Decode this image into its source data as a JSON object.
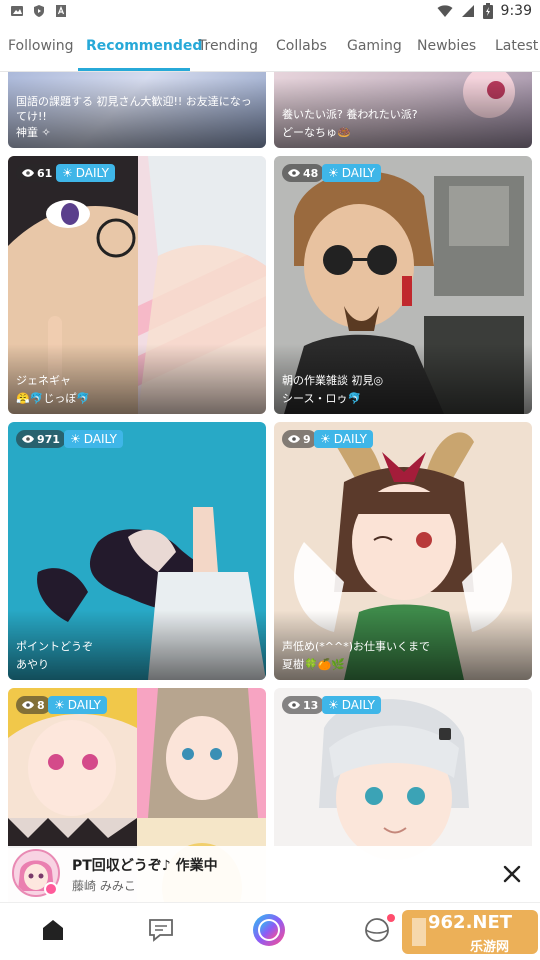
{
  "status_bar": {
    "time": "9:39"
  },
  "tabs": [
    {
      "label": "Following"
    },
    {
      "label": "Recommended"
    },
    {
      "label": "Trending"
    },
    {
      "label": "Collabs"
    },
    {
      "label": "Gaming"
    },
    {
      "label": "Newbies"
    },
    {
      "label": "Latest"
    }
  ],
  "active_tab": "Recommended",
  "cards": [
    {
      "title": "国語の課題する 初見さん大歓迎!! お友達になってけ!!",
      "user": "神童 ✧",
      "viewers": "",
      "daily": ""
    },
    {
      "title": "養いたい派? 養われたい派?",
      "user": "どーなちゅ🍩",
      "viewers": "",
      "daily": ""
    },
    {
      "title": "ジェネギャ",
      "user": "😤🐬じっぽ🐬",
      "viewers": "61",
      "daily": "DAILY"
    },
    {
      "title": "朝の作業雑談 初見◎",
      "user": "シース・ロゥ🐬",
      "viewers": "48",
      "daily": "DAILY"
    },
    {
      "title": "ポイントどうぞ",
      "user": "あやり",
      "viewers": "971",
      "daily": "DAILY"
    },
    {
      "title": "声低め(*^^*)お仕事いくまで",
      "user": "夏樹🍀🍊🌿",
      "viewers": "9",
      "daily": "DAILY"
    },
    {
      "title": "",
      "user": "",
      "viewers": "8",
      "daily": "DAILY"
    },
    {
      "title": "",
      "user": "",
      "viewers": "13",
      "daily": "DAILY"
    }
  ],
  "now_playing": {
    "title": "PT回収どうぞ♪ 作業中",
    "user": "藤崎 みみこ"
  },
  "watermark": {
    "text": "962.NET",
    "subtext": "乐游网"
  },
  "colors": {
    "accent": "#27a9d8",
    "daily_badge": "#3fb6e8",
    "notification_dot": "#ff4d6d"
  }
}
